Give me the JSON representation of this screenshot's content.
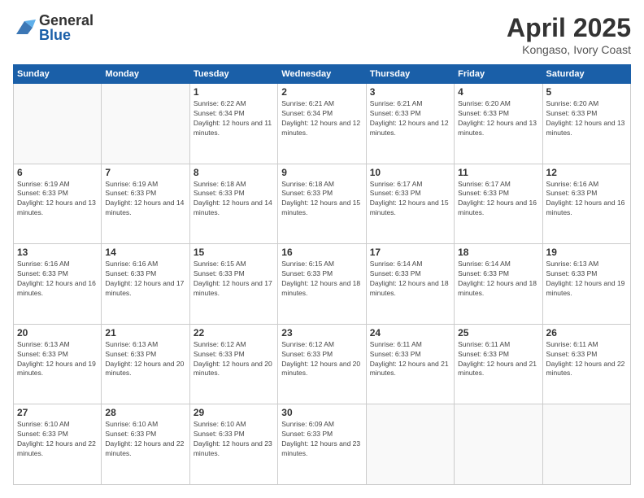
{
  "logo": {
    "general": "General",
    "blue": "Blue"
  },
  "header": {
    "title": "April 2025",
    "location": "Kongaso, Ivory Coast"
  },
  "weekdays": [
    "Sunday",
    "Monday",
    "Tuesday",
    "Wednesday",
    "Thursday",
    "Friday",
    "Saturday"
  ],
  "weeks": [
    [
      {
        "day": "",
        "info": ""
      },
      {
        "day": "",
        "info": ""
      },
      {
        "day": "1",
        "info": "Sunrise: 6:22 AM\nSunset: 6:34 PM\nDaylight: 12 hours and 11 minutes."
      },
      {
        "day": "2",
        "info": "Sunrise: 6:21 AM\nSunset: 6:34 PM\nDaylight: 12 hours and 12 minutes."
      },
      {
        "day": "3",
        "info": "Sunrise: 6:21 AM\nSunset: 6:33 PM\nDaylight: 12 hours and 12 minutes."
      },
      {
        "day": "4",
        "info": "Sunrise: 6:20 AM\nSunset: 6:33 PM\nDaylight: 12 hours and 13 minutes."
      },
      {
        "day": "5",
        "info": "Sunrise: 6:20 AM\nSunset: 6:33 PM\nDaylight: 12 hours and 13 minutes."
      }
    ],
    [
      {
        "day": "6",
        "info": "Sunrise: 6:19 AM\nSunset: 6:33 PM\nDaylight: 12 hours and 13 minutes."
      },
      {
        "day": "7",
        "info": "Sunrise: 6:19 AM\nSunset: 6:33 PM\nDaylight: 12 hours and 14 minutes."
      },
      {
        "day": "8",
        "info": "Sunrise: 6:18 AM\nSunset: 6:33 PM\nDaylight: 12 hours and 14 minutes."
      },
      {
        "day": "9",
        "info": "Sunrise: 6:18 AM\nSunset: 6:33 PM\nDaylight: 12 hours and 15 minutes."
      },
      {
        "day": "10",
        "info": "Sunrise: 6:17 AM\nSunset: 6:33 PM\nDaylight: 12 hours and 15 minutes."
      },
      {
        "day": "11",
        "info": "Sunrise: 6:17 AM\nSunset: 6:33 PM\nDaylight: 12 hours and 16 minutes."
      },
      {
        "day": "12",
        "info": "Sunrise: 6:16 AM\nSunset: 6:33 PM\nDaylight: 12 hours and 16 minutes."
      }
    ],
    [
      {
        "day": "13",
        "info": "Sunrise: 6:16 AM\nSunset: 6:33 PM\nDaylight: 12 hours and 16 minutes."
      },
      {
        "day": "14",
        "info": "Sunrise: 6:16 AM\nSunset: 6:33 PM\nDaylight: 12 hours and 17 minutes."
      },
      {
        "day": "15",
        "info": "Sunrise: 6:15 AM\nSunset: 6:33 PM\nDaylight: 12 hours and 17 minutes."
      },
      {
        "day": "16",
        "info": "Sunrise: 6:15 AM\nSunset: 6:33 PM\nDaylight: 12 hours and 18 minutes."
      },
      {
        "day": "17",
        "info": "Sunrise: 6:14 AM\nSunset: 6:33 PM\nDaylight: 12 hours and 18 minutes."
      },
      {
        "day": "18",
        "info": "Sunrise: 6:14 AM\nSunset: 6:33 PM\nDaylight: 12 hours and 18 minutes."
      },
      {
        "day": "19",
        "info": "Sunrise: 6:13 AM\nSunset: 6:33 PM\nDaylight: 12 hours and 19 minutes."
      }
    ],
    [
      {
        "day": "20",
        "info": "Sunrise: 6:13 AM\nSunset: 6:33 PM\nDaylight: 12 hours and 19 minutes."
      },
      {
        "day": "21",
        "info": "Sunrise: 6:13 AM\nSunset: 6:33 PM\nDaylight: 12 hours and 20 minutes."
      },
      {
        "day": "22",
        "info": "Sunrise: 6:12 AM\nSunset: 6:33 PM\nDaylight: 12 hours and 20 minutes."
      },
      {
        "day": "23",
        "info": "Sunrise: 6:12 AM\nSunset: 6:33 PM\nDaylight: 12 hours and 20 minutes."
      },
      {
        "day": "24",
        "info": "Sunrise: 6:11 AM\nSunset: 6:33 PM\nDaylight: 12 hours and 21 minutes."
      },
      {
        "day": "25",
        "info": "Sunrise: 6:11 AM\nSunset: 6:33 PM\nDaylight: 12 hours and 21 minutes."
      },
      {
        "day": "26",
        "info": "Sunrise: 6:11 AM\nSunset: 6:33 PM\nDaylight: 12 hours and 22 minutes."
      }
    ],
    [
      {
        "day": "27",
        "info": "Sunrise: 6:10 AM\nSunset: 6:33 PM\nDaylight: 12 hours and 22 minutes."
      },
      {
        "day": "28",
        "info": "Sunrise: 6:10 AM\nSunset: 6:33 PM\nDaylight: 12 hours and 22 minutes."
      },
      {
        "day": "29",
        "info": "Sunrise: 6:10 AM\nSunset: 6:33 PM\nDaylight: 12 hours and 23 minutes."
      },
      {
        "day": "30",
        "info": "Sunrise: 6:09 AM\nSunset: 6:33 PM\nDaylight: 12 hours and 23 minutes."
      },
      {
        "day": "",
        "info": ""
      },
      {
        "day": "",
        "info": ""
      },
      {
        "day": "",
        "info": ""
      }
    ]
  ]
}
